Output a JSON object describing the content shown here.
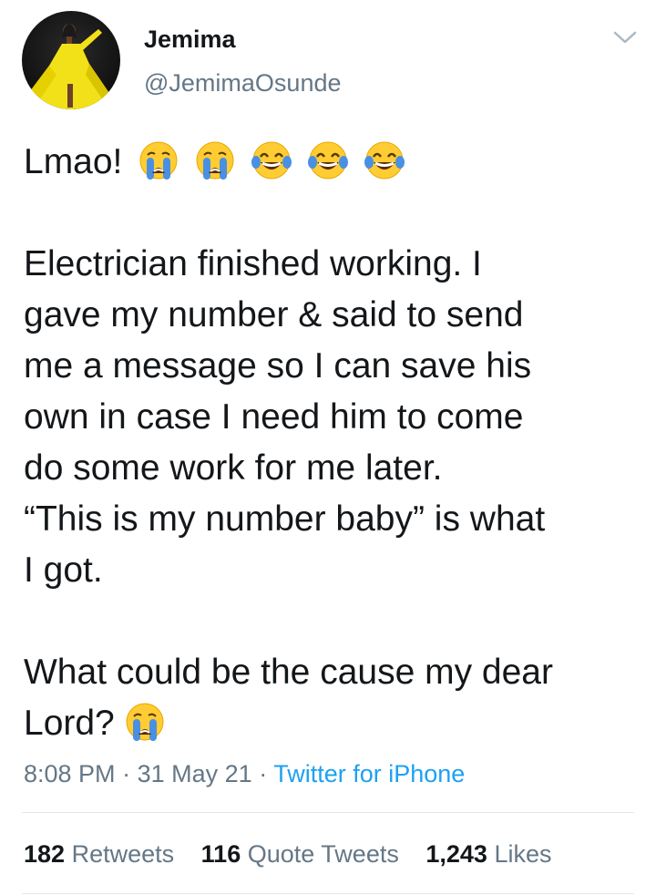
{
  "author": {
    "display_name": "Jemima",
    "handle": "@JemimaOsunde",
    "avatar_icon": "profile-photo-yellow-dress"
  },
  "header": {
    "menu_icon": "chevron-down-icon"
  },
  "tweet": {
    "intro": "Lmao!",
    "intro_emojis": [
      "loudly-crying-face",
      "loudly-crying-face",
      "face-with-tears-of-joy",
      "face-with-tears-of-joy",
      "face-with-tears-of-joy"
    ],
    "body_lines": [
      "Electrician finished working. I",
      "gave my number & said to send",
      "me a message so I can save his",
      "own in case I need him to come",
      "do some work for me later.",
      "“This is my number baby” is what",
      "I got."
    ],
    "closing_lines": [
      "What could be the cause my dear",
      "Lord?"
    ],
    "closing_emoji": "loudly-crying-face"
  },
  "meta": {
    "time": "8:08 PM",
    "separator": "·",
    "date": "31 May 21",
    "source": "Twitter for iPhone"
  },
  "stats": {
    "retweets_count": "182",
    "retweets_label": "Retweets",
    "quotes_count": "116",
    "quotes_label": "Quote Tweets",
    "likes_count": "1,243",
    "likes_label": "Likes"
  },
  "colors": {
    "text": "#14171a",
    "secondary": "#657786",
    "link": "#1da1f2",
    "divider": "#e1e8ed",
    "emoji_yellow": "#ffcc33",
    "tear_blue": "#4a90e2"
  }
}
